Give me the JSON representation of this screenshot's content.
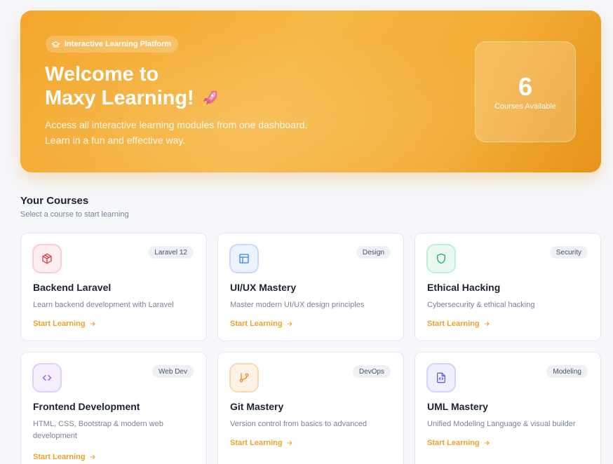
{
  "hero": {
    "badge": "Interactive Learning Platform",
    "title_line1": "Welcome to",
    "title_line2": "Maxy Learning!",
    "desc_line1": "Access all interactive learning modules from one dashboard.",
    "desc_line2": "Learn in a fun and effective way.",
    "stat_number": "6",
    "stat_label": "Courses Available"
  },
  "section": {
    "title": "Your Courses",
    "subtitle": "Select a course to start learning"
  },
  "courses": [
    {
      "tag": "Laravel 12",
      "title": "Backend Laravel",
      "desc": "Learn backend development with Laravel",
      "link": "Start Learning",
      "icon": "cube-icon"
    },
    {
      "tag": "Design",
      "title": "UI/UX Mastery",
      "desc": "Master modern UI/UX design principles",
      "link": "Start Learning",
      "icon": "layout-icon"
    },
    {
      "tag": "Security",
      "title": "Ethical Hacking",
      "desc": "Cybersecurity & ethical hacking",
      "link": "Start Learning",
      "icon": "shield-icon"
    },
    {
      "tag": "Web Dev",
      "title": "Frontend Development",
      "desc": "HTML, CSS, Bootstrap & modern web development",
      "link": "Start Learning",
      "icon": "code-icon"
    },
    {
      "tag": "DevOps",
      "title": "Git Mastery",
      "desc": "Version control from basics to advanced",
      "link": "Start Learning",
      "icon": "git-branch-icon"
    },
    {
      "tag": "Modeling",
      "title": "UML Mastery",
      "desc": "Unified Modeling Language & visual builder",
      "link": "Start Learning",
      "icon": "file-code-icon"
    }
  ],
  "colors": {
    "accent": "#f0a02a",
    "hero_start": "#f3a72c",
    "hero_end": "#e7931a"
  }
}
